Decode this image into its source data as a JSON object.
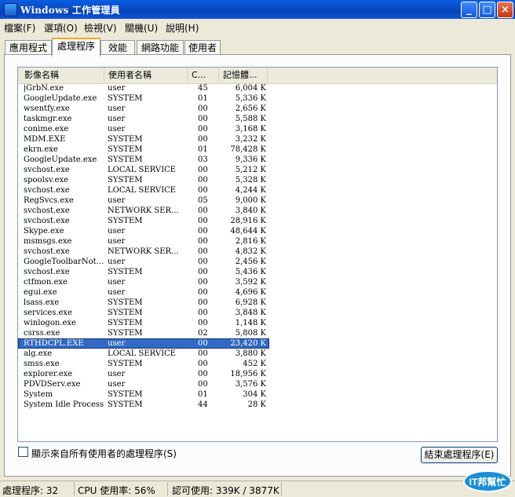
{
  "window": {
    "title": "Windows 工作管理員"
  },
  "menu": [
    "檔案(F)",
    "選項(O)",
    "檢視(V)",
    "關機(U)",
    "說明(H)"
  ],
  "tabs": [
    "應用程式",
    "處理程序",
    "效能",
    "網路功能",
    "使用者"
  ],
  "columns": [
    "影像名稱",
    "使用者名稱",
    "C...",
    "記憶體..."
  ],
  "processes": [
    {
      "name": "jGrbN.exe",
      "user": "user",
      "cpu": "45",
      "mem": "6,004 K"
    },
    {
      "name": "GoogleUpdate.exe",
      "user": "SYSTEM",
      "cpu": "01",
      "mem": "5,336 K"
    },
    {
      "name": "wsentfy.exe",
      "user": "user",
      "cpu": "00",
      "mem": "2,656 K"
    },
    {
      "name": "taskmgr.exe",
      "user": "user",
      "cpu": "00",
      "mem": "5,588 K"
    },
    {
      "name": "conime.exe",
      "user": "user",
      "cpu": "00",
      "mem": "3,168 K"
    },
    {
      "name": "MDM.EXE",
      "user": "SYSTEM",
      "cpu": "00",
      "mem": "3,232 K"
    },
    {
      "name": "ekrn.exe",
      "user": "SYSTEM",
      "cpu": "01",
      "mem": "78,428 K"
    },
    {
      "name": "GoogleUpdate.exe",
      "user": "SYSTEM",
      "cpu": "03",
      "mem": "9,336 K"
    },
    {
      "name": "svchost.exe",
      "user": "LOCAL SERVICE",
      "cpu": "00",
      "mem": "5,212 K"
    },
    {
      "name": "spoolsv.exe",
      "user": "SYSTEM",
      "cpu": "00",
      "mem": "5,328 K"
    },
    {
      "name": "svchost.exe",
      "user": "LOCAL SERVICE",
      "cpu": "00",
      "mem": "4,244 K"
    },
    {
      "name": "RegSvcs.exe",
      "user": "user",
      "cpu": "05",
      "mem": "9,000 K"
    },
    {
      "name": "svchost.exe",
      "user": "NETWORK SER...",
      "cpu": "00",
      "mem": "3,840 K"
    },
    {
      "name": "svchost.exe",
      "user": "SYSTEM",
      "cpu": "00",
      "mem": "28,916 K"
    },
    {
      "name": "Skype.exe",
      "user": "user",
      "cpu": "00",
      "mem": "48,644 K"
    },
    {
      "name": "msmsgs.exe",
      "user": "user",
      "cpu": "00",
      "mem": "2,816 K"
    },
    {
      "name": "svchost.exe",
      "user": "NETWORK SER...",
      "cpu": "00",
      "mem": "4,832 K"
    },
    {
      "name": "GoogleToolbarNot...",
      "user": "user",
      "cpu": "00",
      "mem": "2,456 K"
    },
    {
      "name": "svchost.exe",
      "user": "SYSTEM",
      "cpu": "00",
      "mem": "5,436 K"
    },
    {
      "name": "ctfmon.exe",
      "user": "user",
      "cpu": "00",
      "mem": "3,592 K"
    },
    {
      "name": "egui.exe",
      "user": "user",
      "cpu": "00",
      "mem": "4,696 K"
    },
    {
      "name": "lsass.exe",
      "user": "SYSTEM",
      "cpu": "00",
      "mem": "6,928 K"
    },
    {
      "name": "services.exe",
      "user": "SYSTEM",
      "cpu": "00",
      "mem": "3,848 K"
    },
    {
      "name": "winlogon.exe",
      "user": "SYSTEM",
      "cpu": "00",
      "mem": "1,148 K"
    },
    {
      "name": "csrss.exe",
      "user": "SYSTEM",
      "cpu": "02",
      "mem": "5,808 K"
    },
    {
      "name": "RTHDCPL.EXE",
      "user": "user",
      "cpu": "00",
      "mem": "23,420 K",
      "selected": true
    },
    {
      "name": "alg.exe",
      "user": "LOCAL SERVICE",
      "cpu": "00",
      "mem": "3,880 K"
    },
    {
      "name": "smss.exe",
      "user": "SYSTEM",
      "cpu": "00",
      "mem": "452 K"
    },
    {
      "name": "explorer.exe",
      "user": "user",
      "cpu": "00",
      "mem": "18,956 K"
    },
    {
      "name": "PDVDServ.exe",
      "user": "user",
      "cpu": "00",
      "mem": "3,576 K"
    },
    {
      "name": "System",
      "user": "SYSTEM",
      "cpu": "01",
      "mem": "304 K"
    },
    {
      "name": "System Idle Process",
      "user": "SYSTEM",
      "cpu": "44",
      "mem": "28 K"
    }
  ],
  "show_all_label": "顯示來自所有使用者的處理程序(S)",
  "end_process_label": "結束處理程序(E)",
  "status": {
    "processes": "處理程序: 32",
    "cpu": "CPU 使用率: 56%",
    "commit": "認可使用: 339K / 3877K"
  },
  "logo_text": "IT邦幫忙"
}
